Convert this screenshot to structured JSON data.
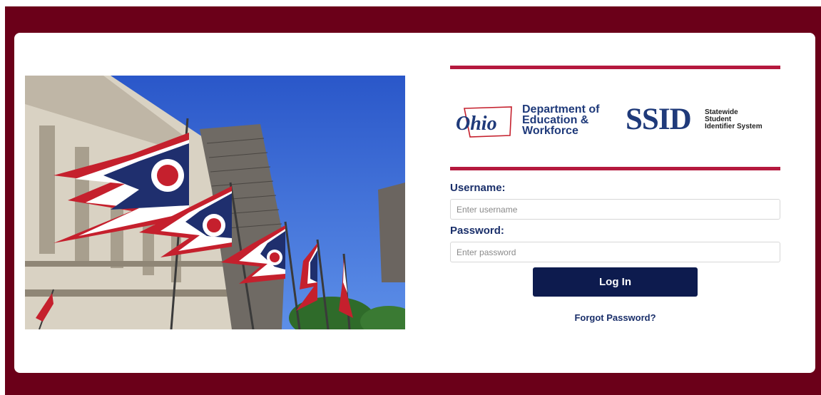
{
  "colors": {
    "frame": "#6b0019",
    "accent_rule": "#b5193e",
    "navy": "#0d1b4e",
    "label_blue": "#1a2f6a"
  },
  "header": {
    "ohio_logo_text": "Ohio",
    "dept_line1": "Department of",
    "dept_line2": "Education &",
    "dept_line3": "Workforce",
    "ssid_logo": "SSID",
    "ssid_desc_line1": "Statewide",
    "ssid_desc_line2": "Student",
    "ssid_desc_line3": "Identifier System"
  },
  "form": {
    "username_label": "Username:",
    "username_placeholder": "Enter username",
    "password_label": "Password:",
    "password_placeholder": "Enter password",
    "login_label": "Log In",
    "forgot_label": "Forgot Password?"
  },
  "image": {
    "subject": "ohio-flags-statehouse-photo"
  }
}
